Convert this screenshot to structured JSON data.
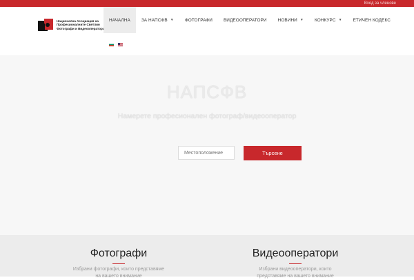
{
  "topbar": {
    "member_login": "Вход за членове"
  },
  "logo": {
    "lines": [
      "Национална Асоциация на",
      "Професионалните Светлин",
      "Фотографи и Видеооператори"
    ]
  },
  "nav": {
    "items": [
      {
        "label": "НАЧАЛНА",
        "dropdown": false,
        "active": true
      },
      {
        "label": "ЗА НАПСФВ",
        "dropdown": true
      },
      {
        "label": "ФОТОГРАФИ",
        "dropdown": false
      },
      {
        "label": "ВИДЕООПЕРАТОРИ",
        "dropdown": false
      },
      {
        "label": "НОВИНИ",
        "dropdown": true
      },
      {
        "label": "КОНКУРС",
        "dropdown": true
      },
      {
        "label": "ЕТИЧЕН КОДЕКС",
        "dropdown": false
      }
    ],
    "languages": [
      "Bulgarian",
      "English"
    ]
  },
  "hero": {
    "title": "НАПСФВ",
    "subtitle": "Намерете професионален фотограф/видеооператор",
    "location_placeholder": "Местоположение",
    "search_label": "Търсене"
  },
  "sections": {
    "photographers": {
      "title": "Фотографи",
      "description_line1": "Избрани фотографи, които представяме",
      "description_line2": "на вашето внимание"
    },
    "videographers": {
      "title": "Видеооператори",
      "description_line1": "Избрани видеооператори, които",
      "description_line2": "представяме на вашето внимание"
    }
  },
  "colors": {
    "accent": "#c8282c",
    "hero_bg": "#f7f7f7",
    "section_bg": "#ececec"
  }
}
